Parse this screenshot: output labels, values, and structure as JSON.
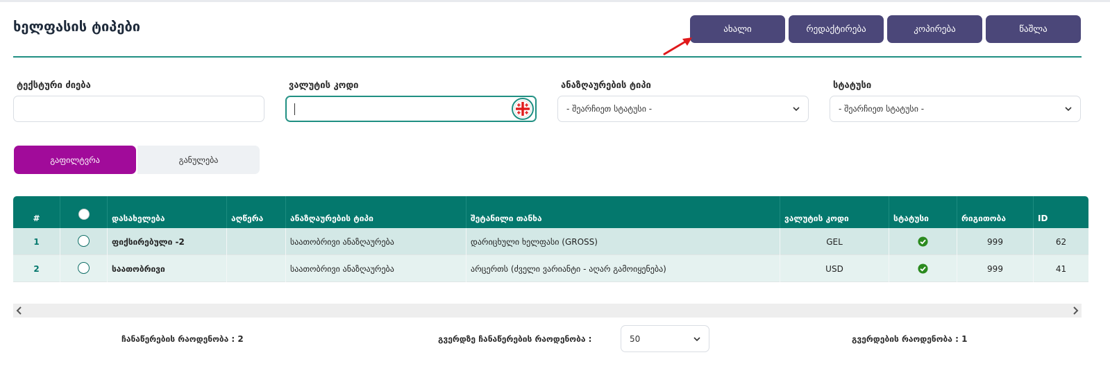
{
  "page": {
    "title": "ხელფასის ტიპები"
  },
  "toolbar": {
    "new_label": "ახალი",
    "edit_label": "რედაქტირება",
    "copy_label": "კოპირება",
    "delete_label": "წაშლა"
  },
  "filters": {
    "text_search": {
      "label": "ტექსტური ძიება",
      "value": ""
    },
    "currency_code": {
      "label": "ვალუტის კოდი",
      "value": ""
    },
    "calc_type": {
      "label": "ანაზღაურების ტიპი",
      "selected": "- შეარჩიეთ სტატუსი -"
    },
    "status": {
      "label": "სტატუსი",
      "selected": "- შეარჩიეთ სტატუსი -"
    },
    "filter_label": "გაფილტვრა",
    "reset_label": "განულება"
  },
  "table": {
    "headers": [
      "#",
      "",
      "დასახელება",
      "აღწერა",
      "ანაზღაურების ტიპი",
      "შეტანილი თანხა",
      "ვალუტის კოდი",
      "სტატუსი",
      "რიგითობა",
      "ID"
    ],
    "rows": [
      {
        "num": "1",
        "name": "ფიქსირებული -2",
        "description": "",
        "calc_type": "საათობრივი ანაზღაურება",
        "amount": "დარიცხული ხელფასი (GROSS)",
        "currency": "GEL",
        "status": "active",
        "order": "999",
        "id": "62"
      },
      {
        "num": "2",
        "name": "საათობრივი",
        "description": "",
        "calc_type": "საათობრივი ანაზღაურება",
        "amount": "არცერთს (ძველი ვარიანტი - აღარ გამოიყენება)",
        "currency": "USD",
        "status": "active",
        "order": "999",
        "id": "41"
      }
    ]
  },
  "footer": {
    "records_count": "ჩანაწერების რაოდენობა : 2",
    "per_page_label": "გვერდზე ჩანაწერების რაოდენობა :",
    "per_page_value": "50",
    "pages_count": "გვერდების რაოდენობა : 1"
  },
  "colors": {
    "toolbar_button": "#4b4779",
    "table_header": "#04786d",
    "filter_button": "#a10b9a",
    "accent_line": "#1f8f82"
  },
  "icons": {
    "status_active": "check-circle-icon",
    "keyboard": "georgian-keyboard-icon"
  }
}
